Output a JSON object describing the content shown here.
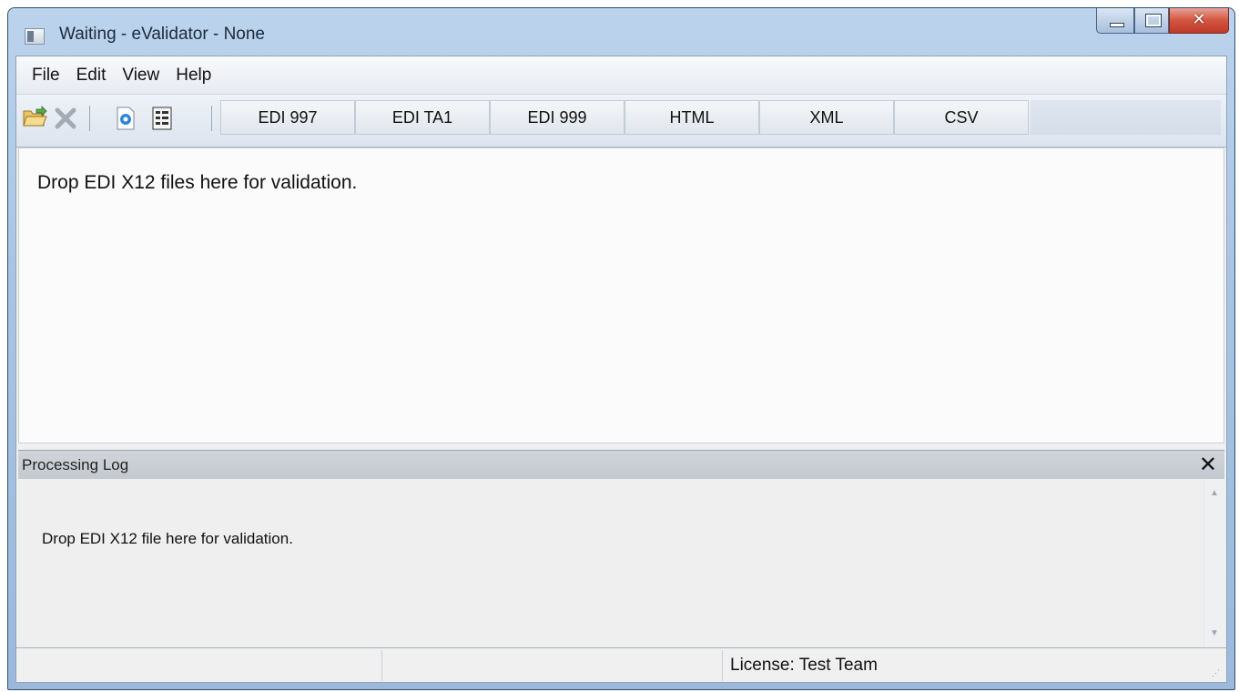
{
  "window": {
    "title": "Waiting - eValidator - None",
    "controls": {
      "minimize": "",
      "maximize": "",
      "close": "✕"
    }
  },
  "menu": {
    "items": [
      {
        "label": "File"
      },
      {
        "label": "Edit"
      },
      {
        "label": "View"
      },
      {
        "label": "Help"
      }
    ]
  },
  "toolbar": {
    "icons": [
      "open-folder-icon",
      "delete-icon",
      "settings-icon",
      "list-icon"
    ],
    "buttons": [
      {
        "label": "EDI 997"
      },
      {
        "label": "EDI TA1"
      },
      {
        "label": "EDI 999"
      },
      {
        "label": "HTML"
      },
      {
        "label": "XML"
      },
      {
        "label": "CSV"
      }
    ]
  },
  "drop_area": {
    "text": "Drop EDI X12 files here for validation."
  },
  "log": {
    "title": "Processing Log",
    "close": "✕",
    "text": "Drop EDI X12 file here for validation."
  },
  "status": {
    "pane1": "",
    "pane2": "",
    "license": "License: Test Team"
  },
  "colors": {
    "title_bar": "#a9c4e3",
    "close_button": "#c0392b",
    "log_header": "#c8cdd4"
  }
}
